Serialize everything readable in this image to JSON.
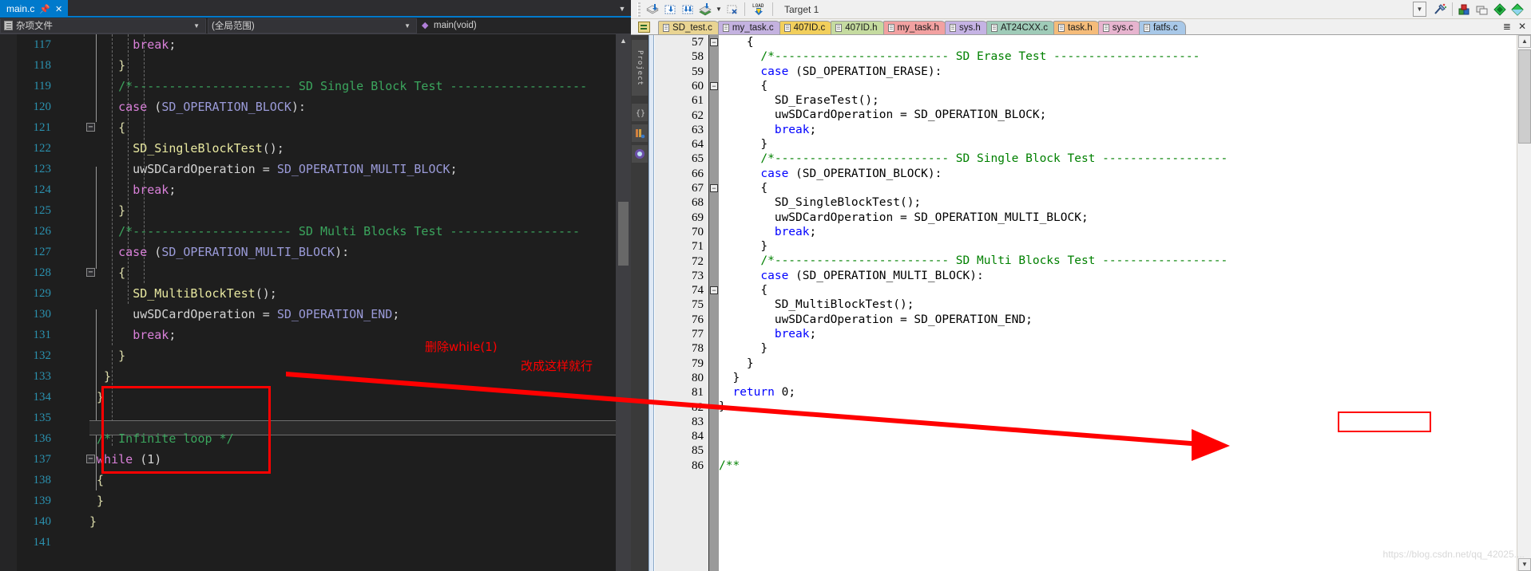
{
  "vs": {
    "tab": {
      "label": "main.c",
      "pin_icon": "pin-icon",
      "close_icon": "close-icon"
    },
    "tabstrip_dropdown_icon": "chevron-down-icon",
    "navbar": {
      "file_combo": "杂项文件",
      "scope_combo": "(全局范围)",
      "member_combo": "main(void)",
      "arrow_icon": "chevron-down-icon"
    },
    "lines": [
      {
        "n": "117",
        "fold": "",
        "code": [
          {
            "t": "      ",
            "c": "k-pn"
          },
          {
            "t": "break",
            "c": "k-kw"
          },
          {
            "t": ";",
            "c": "k-pn"
          }
        ]
      },
      {
        "n": "118",
        "fold": "",
        "code": [
          {
            "t": "    }",
            "c": "k-br"
          }
        ]
      },
      {
        "n": "119",
        "fold": "",
        "code": [
          {
            "t": "    /*---------------------- SD Single Block Test -------------------",
            "c": "k-cmt"
          }
        ]
      },
      {
        "n": "120",
        "fold": "",
        "code": [
          {
            "t": "    case",
            "c": "k-kw"
          },
          {
            "t": " (",
            "c": "k-pn"
          },
          {
            "t": "SD_OPERATION_BLOCK",
            "c": "k-pp"
          },
          {
            "t": "):",
            "c": "k-pn"
          }
        ]
      },
      {
        "n": "121",
        "fold": "-",
        "code": [
          {
            "t": "    {",
            "c": "k-br"
          }
        ]
      },
      {
        "n": "122",
        "fold": "",
        "code": [
          {
            "t": "      ",
            "c": "k-pn"
          },
          {
            "t": "SD_SingleBlockTest",
            "c": "k-fn"
          },
          {
            "t": "();",
            "c": "k-pn"
          }
        ]
      },
      {
        "n": "123",
        "fold": "",
        "code": [
          {
            "t": "      uwSDCardOperation = ",
            "c": "k-id"
          },
          {
            "t": "SD_OPERATION_MULTI_BLOCK",
            "c": "k-pp"
          },
          {
            "t": ";",
            "c": "k-pn"
          }
        ]
      },
      {
        "n": "124",
        "fold": "",
        "code": [
          {
            "t": "      ",
            "c": "k-pn"
          },
          {
            "t": "break",
            "c": "k-kw"
          },
          {
            "t": ";",
            "c": "k-pn"
          }
        ]
      },
      {
        "n": "125",
        "fold": "",
        "code": [
          {
            "t": "    }",
            "c": "k-br"
          }
        ]
      },
      {
        "n": "126",
        "fold": "",
        "code": [
          {
            "t": "    /*---------------------- SD Multi Blocks Test ------------------",
            "c": "k-cmt"
          }
        ]
      },
      {
        "n": "127",
        "fold": "",
        "code": [
          {
            "t": "    case",
            "c": "k-kw"
          },
          {
            "t": " (",
            "c": "k-pn"
          },
          {
            "t": "SD_OPERATION_MULTI_BLOCK",
            "c": "k-pp"
          },
          {
            "t": "):",
            "c": "k-pn"
          }
        ]
      },
      {
        "n": "128",
        "fold": "-",
        "code": [
          {
            "t": "    {",
            "c": "k-br"
          }
        ]
      },
      {
        "n": "129",
        "fold": "",
        "code": [
          {
            "t": "      ",
            "c": "k-pn"
          },
          {
            "t": "SD_MultiBlockTest",
            "c": "k-fn"
          },
          {
            "t": "();",
            "c": "k-pn"
          }
        ]
      },
      {
        "n": "130",
        "fold": "",
        "code": [
          {
            "t": "      uwSDCardOperation = ",
            "c": "k-id"
          },
          {
            "t": "SD_OPERATION_END",
            "c": "k-pp"
          },
          {
            "t": ";",
            "c": "k-pn"
          }
        ]
      },
      {
        "n": "131",
        "fold": "",
        "code": [
          {
            "t": "      ",
            "c": "k-pn"
          },
          {
            "t": "break",
            "c": "k-kw"
          },
          {
            "t": ";",
            "c": "k-pn"
          }
        ]
      },
      {
        "n": "132",
        "fold": "",
        "code": [
          {
            "t": "    }",
            "c": "k-br"
          }
        ]
      },
      {
        "n": "133",
        "fold": "",
        "code": [
          {
            "t": "  }",
            "c": "k-br"
          }
        ]
      },
      {
        "n": "134",
        "fold": "",
        "code": [
          {
            "t": " }",
            "c": "k-br"
          }
        ]
      },
      {
        "n": "135",
        "fold": "",
        "code": [
          {
            "t": "",
            "c": "k-pn"
          }
        ]
      },
      {
        "n": "136",
        "fold": "",
        "code": [
          {
            "t": " /* Infinite loop */",
            "c": "k-cmt"
          }
        ]
      },
      {
        "n": "137",
        "fold": "-",
        "code": [
          {
            "t": " while",
            "c": "k-kw"
          },
          {
            "t": " (1)",
            "c": "k-pn"
          }
        ]
      },
      {
        "n": "138",
        "fold": "",
        "code": [
          {
            "t": " {",
            "c": "k-br"
          }
        ]
      },
      {
        "n": "139",
        "fold": "",
        "code": [
          {
            "t": " }",
            "c": "k-br"
          }
        ]
      },
      {
        "n": "140",
        "fold": "",
        "code": [
          {
            "t": "}",
            "c": "k-br"
          }
        ]
      },
      {
        "n": "141",
        "fold": "",
        "code": [
          {
            "t": "",
            "c": "k-pn"
          }
        ]
      }
    ]
  },
  "keil": {
    "toolbar": {
      "buttons": [
        {
          "name": "translate-icon",
          "glyph": "⬇"
        },
        {
          "name": "build-target-icon",
          "glyph": "⬇"
        },
        {
          "name": "rebuild-all-icon",
          "glyph": "⬇"
        },
        {
          "name": "batch-build-icon",
          "glyph": "⬇"
        },
        {
          "name": "stop-build-icon",
          "glyph": "✕"
        },
        {
          "name": "download-icon",
          "glyph": "LOAD"
        }
      ],
      "target_label": "Target 1",
      "target_arrow_icon": "chevron-down-icon",
      "right_buttons": [
        {
          "name": "target-options-icon"
        },
        {
          "name": "manage-project-items-icon"
        },
        {
          "name": "multi-project-icon"
        },
        {
          "name": "pack-installer-icon"
        },
        {
          "name": "manage-run-env-icon"
        }
      ]
    },
    "tabs": [
      {
        "label": "SD_test.c",
        "color": "#e9d492"
      },
      {
        "label": "my_task.c",
        "color": "#c4b2e0"
      },
      {
        "label": "407ID.c",
        "color": "#f2cf5c"
      },
      {
        "label": "407ID.h",
        "color": "#c5dba0"
      },
      {
        "label": "my_task.h",
        "color": "#f2a1a1"
      },
      {
        "label": "sys.h",
        "color": "#c5b3e4"
      },
      {
        "label": "AT24CXX.c",
        "color": "#9fcbb8"
      },
      {
        "label": "task.h",
        "color": "#f5bc7a"
      },
      {
        "label": "sys.c",
        "color": "#e7b4cf"
      },
      {
        "label": "fatfs.c",
        "color": "#a8c8e8"
      }
    ],
    "tabs_right_icons": [
      {
        "name": "tab-list-icon",
        "glyph": "☰"
      },
      {
        "name": "close-tab-icon",
        "glyph": "✕"
      }
    ],
    "sidebar": {
      "project_label": "Project",
      "icons": [
        {
          "name": "books-icon"
        },
        {
          "name": "functions-icon"
        },
        {
          "name": "templates-icon"
        }
      ]
    },
    "lines": [
      {
        "n": "57",
        "fold": "-",
        "code": [
          {
            "t": "    {",
            "c": "c-txt"
          }
        ]
      },
      {
        "n": "58",
        "fold": "",
        "code": [
          {
            "t": "      /*------------------------- SD Erase Test ---------------------",
            "c": "c-cmt"
          }
        ]
      },
      {
        "n": "59",
        "fold": "",
        "code": [
          {
            "t": "      case",
            "c": "c-kw"
          },
          {
            "t": " (SD_OPERATION_ERASE):",
            "c": "c-txt"
          }
        ]
      },
      {
        "n": "60",
        "fold": "-",
        "code": [
          {
            "t": "      {",
            "c": "c-txt"
          }
        ]
      },
      {
        "n": "61",
        "fold": "",
        "code": [
          {
            "t": "        SD_EraseTest();",
            "c": "c-txt"
          }
        ]
      },
      {
        "n": "62",
        "fold": "",
        "code": [
          {
            "t": "        uwSDCardOperation = SD_OPERATION_BLOCK;",
            "c": "c-txt"
          }
        ]
      },
      {
        "n": "63",
        "fold": "",
        "code": [
          {
            "t": "        ",
            "c": "c-txt"
          },
          {
            "t": "break",
            "c": "c-kw"
          },
          {
            "t": ";",
            "c": "c-txt"
          }
        ]
      },
      {
        "n": "64",
        "fold": "",
        "code": [
          {
            "t": "      }",
            "c": "c-txt"
          }
        ]
      },
      {
        "n": "65",
        "fold": "",
        "code": [
          {
            "t": "      /*------------------------- SD Single Block Test ------------------",
            "c": "c-cmt"
          }
        ]
      },
      {
        "n": "66",
        "fold": "",
        "code": [
          {
            "t": "      case",
            "c": "c-kw"
          },
          {
            "t": " (SD_OPERATION_BLOCK):",
            "c": "c-txt"
          }
        ]
      },
      {
        "n": "67",
        "fold": "-",
        "code": [
          {
            "t": "      {",
            "c": "c-txt"
          }
        ]
      },
      {
        "n": "68",
        "fold": "",
        "code": [
          {
            "t": "        SD_SingleBlockTest();",
            "c": "c-txt"
          }
        ]
      },
      {
        "n": "69",
        "fold": "",
        "code": [
          {
            "t": "        uwSDCardOperation = SD_OPERATION_MULTI_BLOCK;",
            "c": "c-txt"
          }
        ]
      },
      {
        "n": "70",
        "fold": "",
        "code": [
          {
            "t": "        ",
            "c": "c-txt"
          },
          {
            "t": "break",
            "c": "c-kw"
          },
          {
            "t": ";",
            "c": "c-txt"
          }
        ]
      },
      {
        "n": "71",
        "fold": "",
        "code": [
          {
            "t": "      }",
            "c": "c-txt"
          }
        ]
      },
      {
        "n": "72",
        "fold": "",
        "code": [
          {
            "t": "      /*------------------------- SD Multi Blocks Test ------------------",
            "c": "c-cmt"
          }
        ]
      },
      {
        "n": "73",
        "fold": "",
        "code": [
          {
            "t": "      case",
            "c": "c-kw"
          },
          {
            "t": " (SD_OPERATION_MULTI_BLOCK):",
            "c": "c-txt"
          }
        ]
      },
      {
        "n": "74",
        "fold": "-",
        "code": [
          {
            "t": "      {",
            "c": "c-txt"
          }
        ]
      },
      {
        "n": "75",
        "fold": "",
        "code": [
          {
            "t": "        SD_MultiBlockTest();",
            "c": "c-txt"
          }
        ]
      },
      {
        "n": "76",
        "fold": "",
        "code": [
          {
            "t": "        uwSDCardOperation = SD_OPERATION_END;",
            "c": "c-txt"
          }
        ]
      },
      {
        "n": "77",
        "fold": "",
        "code": [
          {
            "t": "        ",
            "c": "c-txt"
          },
          {
            "t": "break",
            "c": "c-kw"
          },
          {
            "t": ";",
            "c": "c-txt"
          }
        ]
      },
      {
        "n": "78",
        "fold": "",
        "code": [
          {
            "t": "      }",
            "c": "c-txt"
          }
        ]
      },
      {
        "n": "79",
        "fold": "",
        "code": [
          {
            "t": "    }",
            "c": "c-txt"
          }
        ]
      },
      {
        "n": "80",
        "fold": "",
        "code": [
          {
            "t": "  }",
            "c": "c-txt"
          }
        ]
      },
      {
        "n": "81",
        "fold": "",
        "code": [
          {
            "t": "  ",
            "c": "c-txt"
          },
          {
            "t": "return",
            "c": "c-kw"
          },
          {
            "t": " 0;",
            "c": "c-txt"
          }
        ]
      },
      {
        "n": "82",
        "fold": "",
        "code": [
          {
            "t": "}",
            "c": "c-txt"
          }
        ]
      },
      {
        "n": "83",
        "fold": "",
        "code": [
          {
            "t": "",
            "c": "c-txt"
          }
        ]
      },
      {
        "n": "84",
        "fold": "",
        "code": [
          {
            "t": "",
            "c": "c-txt"
          }
        ]
      },
      {
        "n": "85",
        "fold": "",
        "code": [
          {
            "t": "",
            "c": "c-txt"
          }
        ]
      },
      {
        "n": "86",
        "fold": "",
        "code": [
          {
            "t": "/**",
            "c": "c-cmt"
          }
        ]
      }
    ]
  },
  "annotations": {
    "note1": "删除while(1)",
    "note2": "改成这样就行",
    "arrow_color": "#ff0000",
    "box_color": "#ff0000"
  },
  "watermark": "https://blog.csdn.net/qq_42025...."
}
